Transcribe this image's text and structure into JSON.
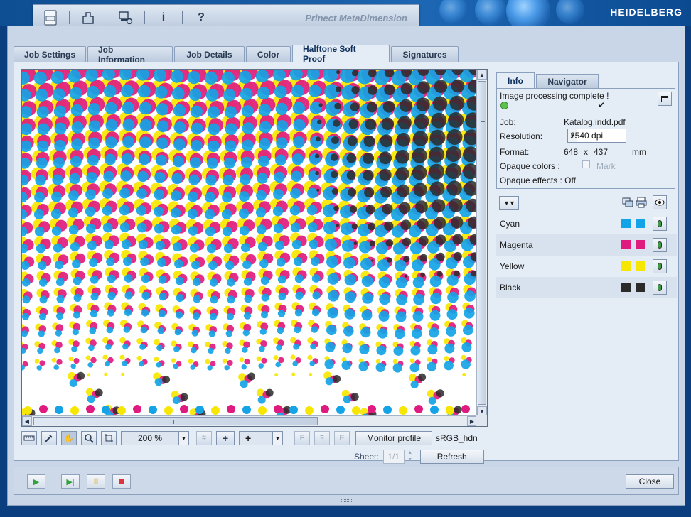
{
  "header": {
    "app_title": "Prinect MetaDimension",
    "brand": "HEIDELBERG",
    "icons": [
      "job-ticket-icon",
      "output-icon",
      "system-settings-icon",
      "info-icon",
      "help-icon"
    ]
  },
  "tabs": [
    {
      "label": "Job Settings",
      "active": false
    },
    {
      "label": "Job Information",
      "active": false
    },
    {
      "label": "Job Details",
      "active": false
    },
    {
      "label": "Color",
      "active": false
    },
    {
      "label": "Halftone Soft Proof",
      "active": true
    },
    {
      "label": "Signatures",
      "active": false
    }
  ],
  "viewer_toolbar": {
    "zoom": "200 %",
    "plus_label": "+",
    "plus_combo": "+",
    "monitor_profile_label": "Monitor profile",
    "monitor_profile_value": "sRGB_hdn",
    "sheet_label": "Sheet:",
    "sheet_value": "1/1",
    "refresh_label": "Refresh"
  },
  "right_panel": {
    "tabs": [
      {
        "label": "Info",
        "active": true
      },
      {
        "label": "Navigator",
        "active": false
      }
    ],
    "status": "Image processing complete !",
    "job_label": "Job:",
    "job_value": "Katalog.indd.pdf",
    "resolution_label": "Resolution:",
    "resolution_value": "2540 dpi",
    "format_label": "Format:",
    "format_w": "648",
    "format_x": "x",
    "format_h": "437",
    "format_unit": "mm",
    "opaque_colors_label": "Opaque colors :",
    "mark_label": "Mark",
    "opaque_effects_label": "Opaque effects : Off",
    "separations": [
      {
        "name": "Cyan",
        "color": "#13a3e6"
      },
      {
        "name": "Magenta",
        "color": "#e01b7f"
      },
      {
        "name": "Yellow",
        "color": "#f7e600"
      },
      {
        "name": "Black",
        "color": "#2a2a2a"
      }
    ]
  },
  "footer": {
    "close_label": "Close"
  }
}
